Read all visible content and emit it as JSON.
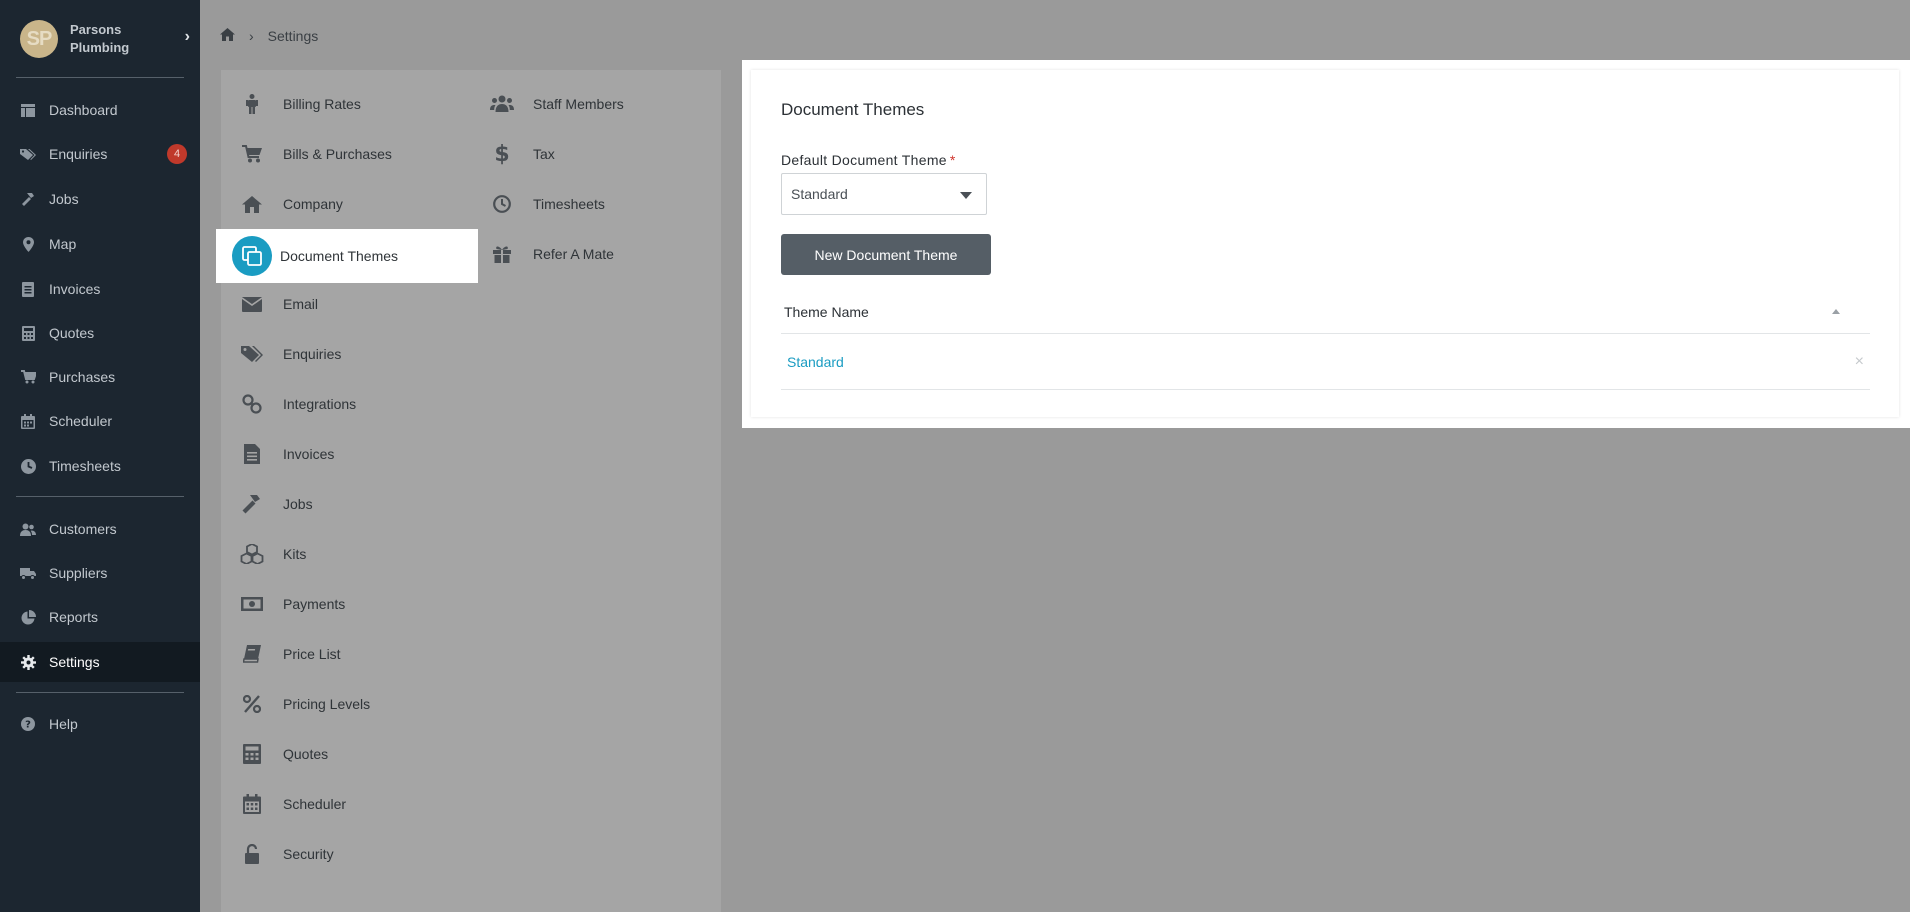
{
  "sidebar": {
    "brand": {
      "initials": "SP",
      "name": "Parsons Plumbing"
    },
    "items": [
      {
        "key": "dashboard",
        "label": "Dashboard"
      },
      {
        "key": "enquiries",
        "label": "Enquiries",
        "badge": "4"
      },
      {
        "key": "jobs",
        "label": "Jobs"
      },
      {
        "key": "map",
        "label": "Map"
      },
      {
        "key": "invoices",
        "label": "Invoices"
      },
      {
        "key": "quotes",
        "label": "Quotes"
      },
      {
        "key": "purchases",
        "label": "Purchases"
      },
      {
        "key": "scheduler",
        "label": "Scheduler"
      },
      {
        "key": "timesheets",
        "label": "Timesheets"
      },
      {
        "key": "customers",
        "label": "Customers"
      },
      {
        "key": "suppliers",
        "label": "Suppliers"
      },
      {
        "key": "reports",
        "label": "Reports"
      },
      {
        "key": "settings",
        "label": "Settings",
        "active": true
      },
      {
        "key": "help",
        "label": "Help"
      }
    ]
  },
  "breadcrumb": {
    "current": "Settings"
  },
  "settings_menu": {
    "left": [
      "Billing Rates",
      "Bills & Purchases",
      "Company",
      "Document Themes",
      "Email",
      "Enquiries",
      "Integrations",
      "Invoices",
      "Jobs",
      "Kits",
      "Payments",
      "Price List",
      "Pricing Levels",
      "Quotes",
      "Scheduler",
      "Security"
    ],
    "right": [
      "Staff Members",
      "Tax",
      "Timesheets",
      "Refer A Mate"
    ],
    "selected": "Document Themes"
  },
  "document_themes": {
    "title": "Document Themes",
    "default_label": "Default Document Theme",
    "required_marker": "*",
    "selected_theme": "Standard",
    "new_button": "New Document Theme",
    "table": {
      "column": "Theme Name",
      "rows": [
        {
          "name": "Standard",
          "delete_glyph": "×"
        }
      ]
    }
  },
  "colors": {
    "sidebar_bg": "#1c2630",
    "accent": "#1a9cc2",
    "button_bg": "#555e66",
    "badge": "#c0392b",
    "overlay": "#9a9a9a"
  }
}
